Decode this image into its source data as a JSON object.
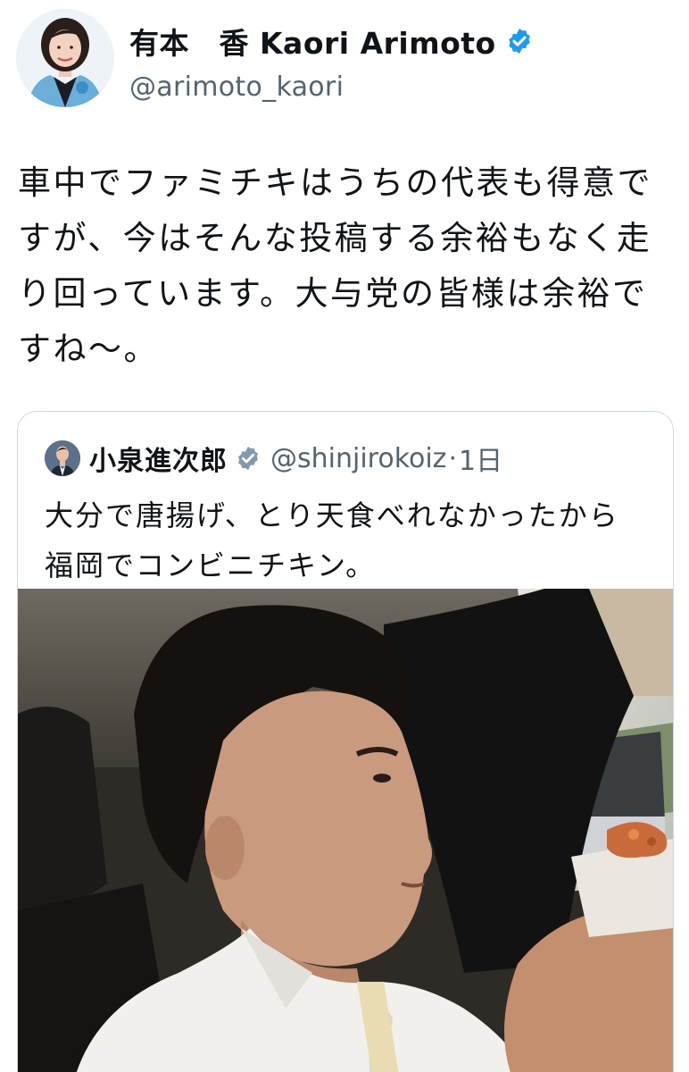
{
  "post": {
    "author": {
      "display_name": "有本　香  Kaori Arimoto",
      "handle": "@arimoto_kaori",
      "verified_icon": "verified-badge-icon",
      "verified_color": "#1d9bf0"
    },
    "text_lines": [
      "車中でファミチキはうちの代表も得意で",
      "すが、今はそんな投稿する余裕もなく走",
      "り回っています。大与党の皆様は余裕で",
      "すね〜。"
    ]
  },
  "quote": {
    "author": {
      "display_name": "小泉進次郎",
      "handle": "@shinjirokoiz",
      "separator": "·",
      "time": "1日",
      "verified_icon": "verified-badge-gray-icon",
      "verified_color": "#829aab"
    },
    "text_lines": [
      "大分で唐揚げ、とり天食べれなかったから",
      "福岡でコンビニチキン。"
    ],
    "media": "video-thumbnail"
  }
}
